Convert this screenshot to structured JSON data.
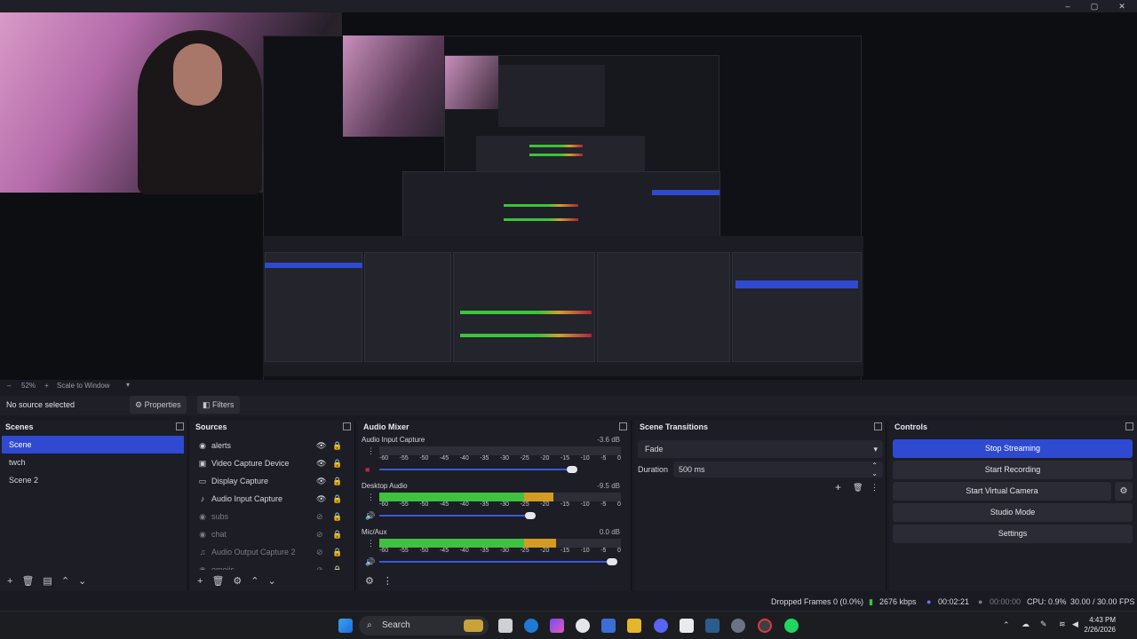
{
  "window": {
    "minimize": "–",
    "maximize": "▢",
    "close": "✕"
  },
  "preview_status": {
    "zoom": "52%",
    "scale_mode": "Scale to Window"
  },
  "toolbar": {
    "no_source": "No source selected",
    "properties": "Properties",
    "filters": "Filters"
  },
  "scenes": {
    "title": "Scenes",
    "items": [
      {
        "label": "Scene",
        "selected": true
      },
      {
        "label": "twch"
      },
      {
        "label": "Scene 2"
      }
    ]
  },
  "sources": {
    "title": "Sources",
    "items": [
      {
        "label": "alerts",
        "icon": "globe-icon",
        "visible": true
      },
      {
        "label": "Video Capture Device",
        "icon": "camera-icon",
        "visible": true
      },
      {
        "label": "Display Capture",
        "icon": "monitor-icon",
        "visible": true
      },
      {
        "label": "Audio Input Capture",
        "icon": "mic-icon",
        "visible": true
      },
      {
        "label": "subs",
        "icon": "globe-icon",
        "visible": false
      },
      {
        "label": "chat",
        "icon": "globe-icon",
        "visible": false
      },
      {
        "label": "Audio Output Capture 2",
        "icon": "speaker-icon",
        "visible": false
      },
      {
        "label": "emojis",
        "icon": "globe-icon",
        "visible": false
      }
    ]
  },
  "mixer": {
    "title": "Audio Mixer",
    "ticks": [
      "-60",
      "-55",
      "-50",
      "-45",
      "-40",
      "-35",
      "-30",
      "-25",
      "-20",
      "-15",
      "-10",
      "-5",
      "0"
    ],
    "channels": [
      {
        "name": "Audio Input Capture",
        "db": "-3.6 dB",
        "level": 0,
        "volume": 0.83,
        "muted": true
      },
      {
        "name": "Desktop Audio",
        "db": "-9.5 dB",
        "level": 0.72,
        "volume": 0.65,
        "muted": false
      },
      {
        "name": "Mic/Aux",
        "db": "0.0 dB",
        "level": 0.73,
        "volume": 1.0,
        "muted": false
      }
    ]
  },
  "transitions": {
    "title": "Scene Transitions",
    "selected": "Fade",
    "duration_label": "Duration",
    "duration_value": "500 ms"
  },
  "controls": {
    "title": "Controls",
    "stop_streaming": "Stop Streaming",
    "start_recording": "Start Recording",
    "start_virtual_camera": "Start Virtual Camera",
    "studio_mode": "Studio Mode",
    "settings": "Settings"
  },
  "status": {
    "dropped_frames": "Dropped Frames 0 (0.0%)",
    "bitrate": "2676 kbps",
    "stream_time": "00:02:21",
    "record_time": "00:00:00",
    "cpu": "CPU: 0.9%",
    "fps": "30.00 / 30.00 FPS"
  },
  "taskbar": {
    "search": "Search",
    "time": "4:43 PM",
    "date": "2/26/2026"
  },
  "colors": {
    "accent": "#2f4ad0",
    "meter_green": "#3fc23f",
    "meter_yellow": "#d39b22",
    "meter_red": "#a1203a"
  }
}
